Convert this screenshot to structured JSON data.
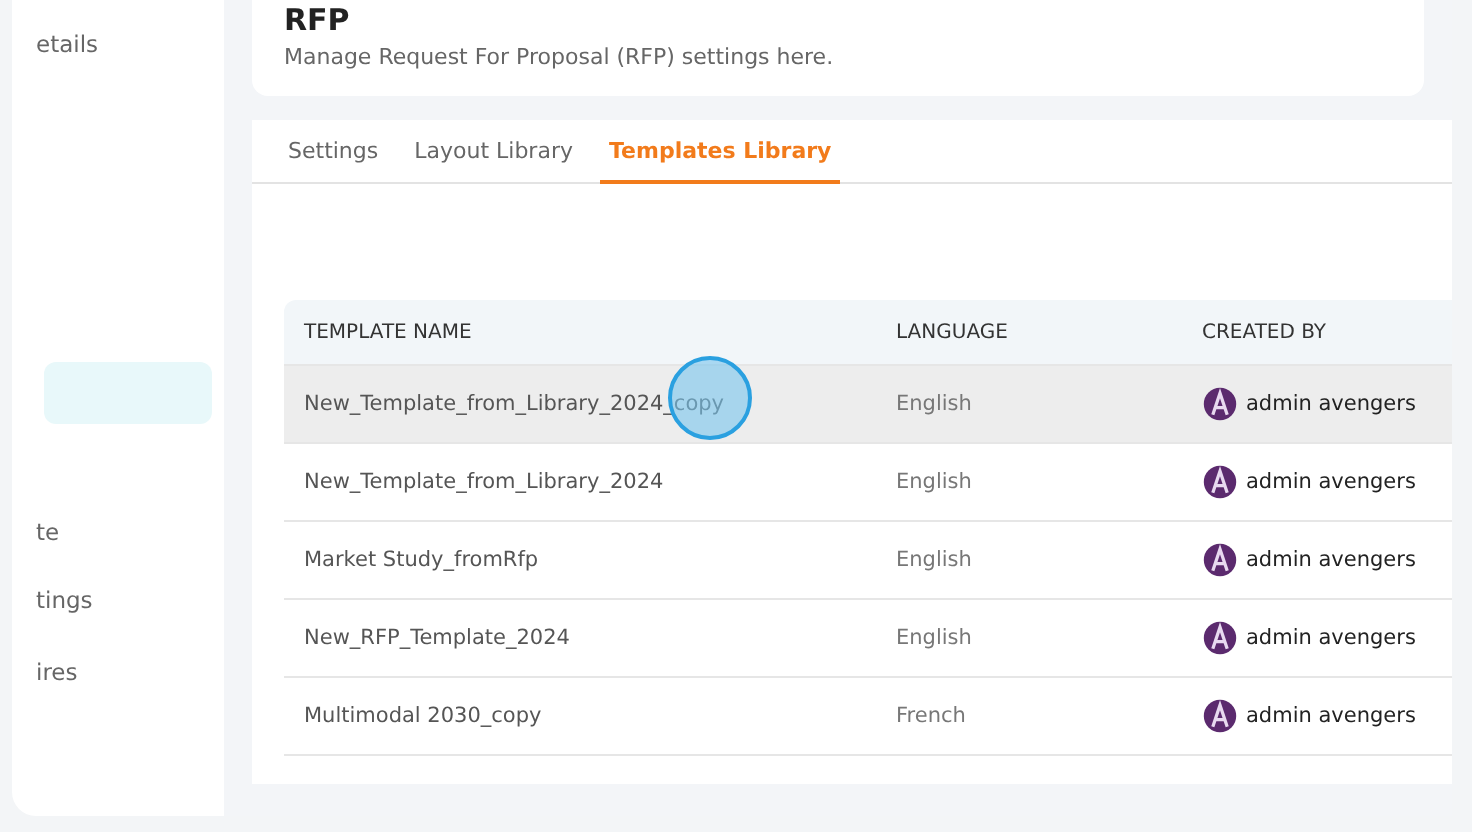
{
  "sidebar": {
    "items": [
      {
        "label": "etails",
        "selected": false
      },
      {
        "selected": true
      },
      {
        "label": "te",
        "selected": false
      },
      {
        "label": "tings",
        "selected": false
      },
      {
        "label": "ires",
        "selected": false
      }
    ]
  },
  "header": {
    "title": "RFP",
    "subtitle": "Manage Request For Proposal (RFP) settings here."
  },
  "tabs": [
    {
      "label": "Settings",
      "selected": false
    },
    {
      "label": "Layout Library",
      "selected": false
    },
    {
      "label": "Templates Library",
      "selected": true
    }
  ],
  "table": {
    "columns": [
      "TEMPLATE NAME",
      "LANGUAGE",
      "CREATED BY"
    ],
    "rows": [
      {
        "name": "New_Template_from_Library_2024_copy",
        "language": "English",
        "created_by": "admin avengers",
        "highlighted": true
      },
      {
        "name": "New_Template_from_Library_2024",
        "language": "English",
        "created_by": "admin avengers",
        "highlighted": false
      },
      {
        "name": "Market Study_fromRfp",
        "language": "English",
        "created_by": "admin avengers",
        "highlighted": false
      },
      {
        "name": "New_RFP_Template_2024",
        "language": "English",
        "created_by": "admin avengers",
        "highlighted": false
      },
      {
        "name": "Multimodal 2030_copy",
        "language": "French",
        "created_by": "admin avengers",
        "highlighted": false
      }
    ]
  }
}
